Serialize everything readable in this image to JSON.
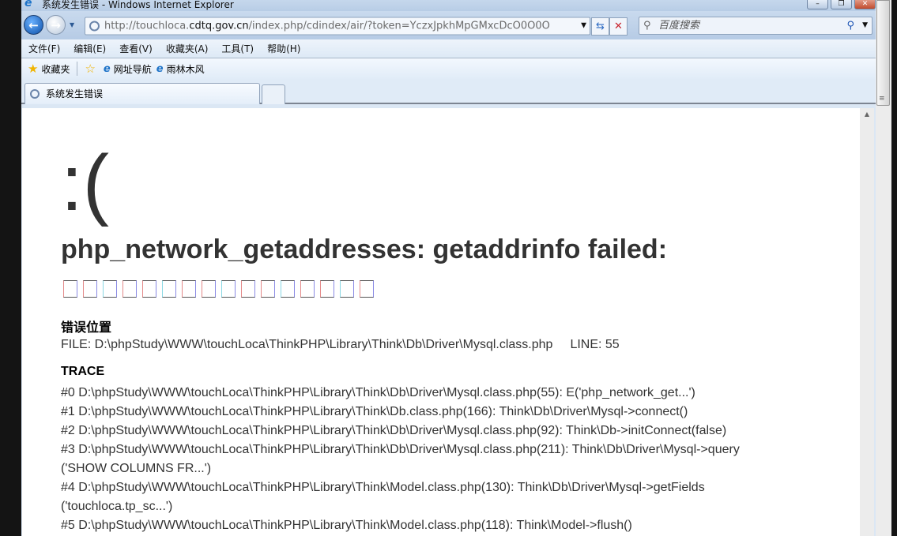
{
  "window": {
    "title": "系统发生错误 - Windows Internet Explorer"
  },
  "address": {
    "url_prefix": "http://touchloca.",
    "url_domain": "cdtq.gov.cn",
    "url_suffix": "/index.php/cdindex/air/?token=YczxJpkhMpGMxcDcO0O0O"
  },
  "search": {
    "placeholder": "百度搜索"
  },
  "menu": [
    "文件(F)",
    "编辑(E)",
    "查看(V)",
    "收藏夹(A)",
    "工具(T)",
    "帮助(H)"
  ],
  "favorites": {
    "label": "收藏夹",
    "links": [
      "网址导航",
      "雨林木风"
    ]
  },
  "tab": {
    "title": "系统发生错误"
  },
  "page": {
    "face": ":(",
    "message": "php_network_getaddresses: getaddrinfo failed:",
    "garbled": "□□□□□□□□□□□□□□□□",
    "location_heading": "错误位置",
    "file_label": "FILE: D:\\phpStudy\\WWW\\touchLoca\\ThinkPHP\\Library\\Think\\Db\\Driver\\Mysql.class.php",
    "line_label": "LINE: 55",
    "trace_heading": "TRACE",
    "trace": [
      "#0 D:\\phpStudy\\WWW\\touchLoca\\ThinkPHP\\Library\\Think\\Db\\Driver\\Mysql.class.php(55): E('php_network_get...')",
      "#1 D:\\phpStudy\\WWW\\touchLoca\\ThinkPHP\\Library\\Think\\Db.class.php(166): Think\\Db\\Driver\\Mysql->connect()",
      "#2 D:\\phpStudy\\WWW\\touchLoca\\ThinkPHP\\Library\\Think\\Db\\Driver\\Mysql.class.php(92): Think\\Db->initConnect(false)",
      "#3 D:\\phpStudy\\WWW\\touchLoca\\ThinkPHP\\Library\\Think\\Db\\Driver\\Mysql.class.php(211): Think\\Db\\Driver\\Mysql->query",
      "('SHOW COLUMNS FR...')",
      "#4 D:\\phpStudy\\WWW\\touchLoca\\ThinkPHP\\Library\\Think\\Model.class.php(130): Think\\Db\\Driver\\Mysql->getFields",
      "('touchloca.tp_sc...')",
      "#5 D:\\phpStudy\\WWW\\touchLoca\\ThinkPHP\\Library\\Think\\Model.class.php(118): Think\\Model->flush()"
    ]
  }
}
